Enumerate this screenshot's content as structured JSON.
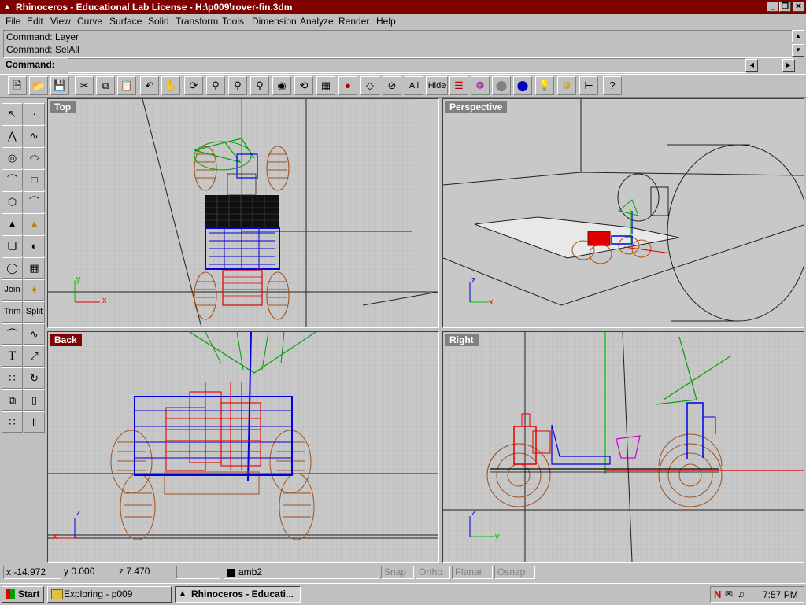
{
  "window": {
    "title": "Rhinoceros - Educational Lab License - H:\\p009\\rover-fin.3dm"
  },
  "menu": [
    "File",
    "Edit",
    "View",
    "Curve",
    "Surface",
    "Solid",
    "Transform",
    "Tools",
    "Dimension",
    "Analyze",
    "Render",
    "Help"
  ],
  "command_history": [
    "Command: Layer",
    "Command: SelAll"
  ],
  "command_prompt": "Command:",
  "toolbar": {
    "all_label": "All",
    "hide_label": "Hide"
  },
  "left_tools": {
    "join_label": "Join",
    "trim_label": "Trim",
    "split_label": "Split"
  },
  "viewports": {
    "top": {
      "label": "Top",
      "axis_x": "x",
      "axis_y": "y"
    },
    "perspective": {
      "label": "Perspective",
      "axis_x": "x",
      "axis_z": "z"
    },
    "back": {
      "label": "Back",
      "axis_x": "x",
      "axis_z": "z"
    },
    "right": {
      "label": "Right",
      "axis_y": "y",
      "axis_z": "z"
    }
  },
  "status": {
    "x": "x  -14.972",
    "y": "y  0.000",
    "z": "z  7.470",
    "layer": "amb2",
    "snap": "Snap",
    "ortho": "Ortho",
    "planar": "Planar",
    "osnap": "Osnap"
  },
  "taskbar": {
    "start": "Start",
    "tasks": [
      "Exploring - p009",
      "Rhinoceros - Educati..."
    ],
    "clock": "7:57 PM"
  },
  "colors": {
    "titlebar": "#800000",
    "desktop": "#c0c0c0",
    "rover_body": "#a0521c",
    "x_axis": "#e00000",
    "y_axis": "#00c000",
    "z_axis": "#0000e0"
  }
}
